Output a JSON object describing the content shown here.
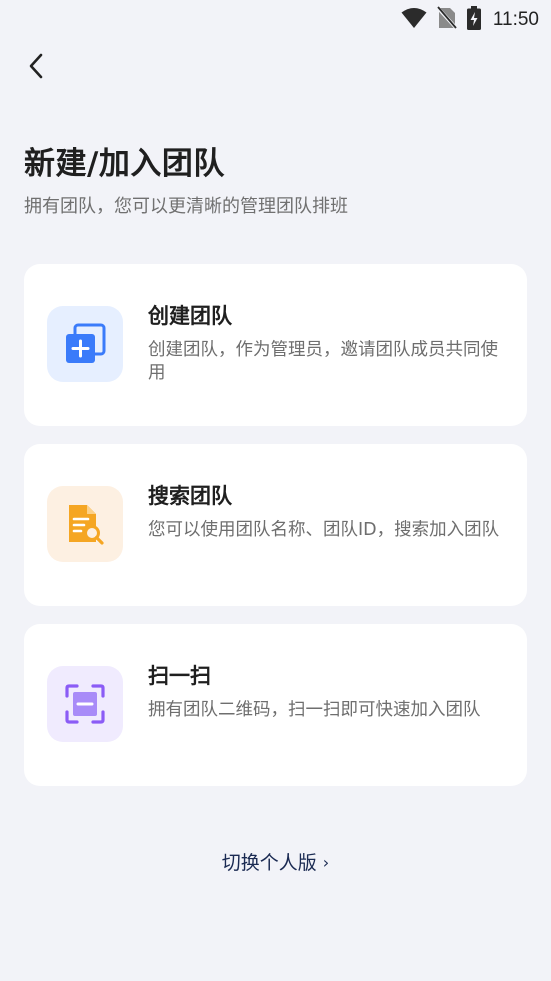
{
  "status_bar": {
    "time": "11:50",
    "icons": [
      "wifi-icon",
      "no-sim-icon",
      "battery-charging-icon"
    ]
  },
  "header": {
    "back_icon": "chevron-left-icon",
    "title": "新建/加入团队",
    "subtitle": "拥有团队，您可以更清晰的管理团队排班"
  },
  "cards": [
    {
      "icon": "create-team-icon",
      "icon_color": "#3a7bfa",
      "title": "创建团队",
      "description": "创建团队，作为管理员，邀请团队成员共同使用"
    },
    {
      "icon": "search-team-icon",
      "icon_color": "#f5a623",
      "title": "搜索团队",
      "description": "您可以使用团队名称、团队ID，搜索加入团队"
    },
    {
      "icon": "scan-icon",
      "icon_color": "#8b5cf6",
      "title": "扫一扫",
      "description": "拥有团队二维码，扫一扫即可快速加入团队"
    }
  ],
  "footer": {
    "switch_label": "切换个人版",
    "switch_icon": "chevron-right-icon"
  }
}
